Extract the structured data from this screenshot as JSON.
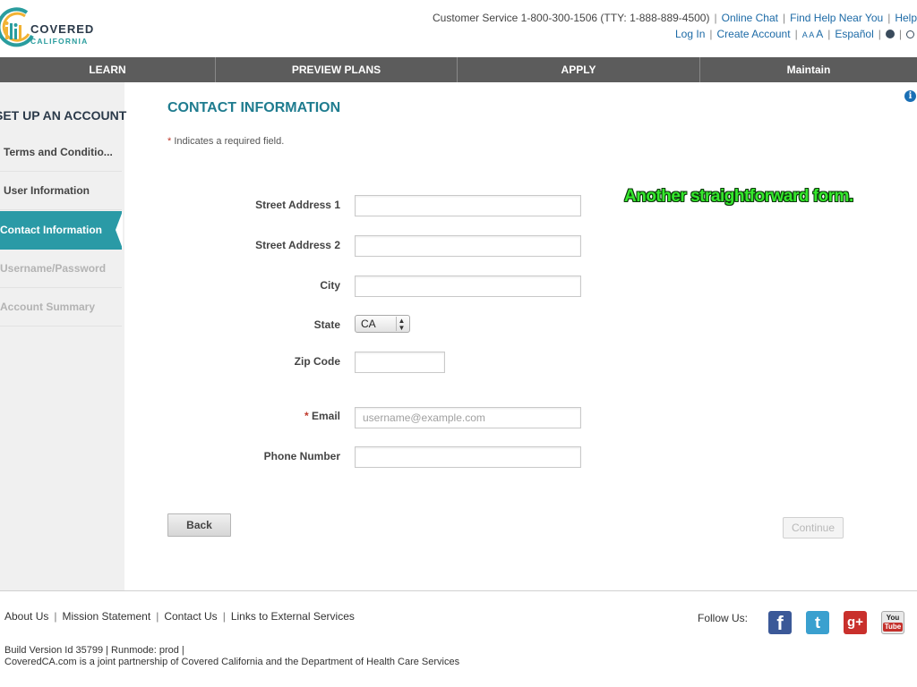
{
  "header": {
    "logo_line1": "COVERED",
    "logo_line2": "CALIFORNIA",
    "customer_service": "Customer Service 1-800-300-1506 (TTY: 1-888-889-4500)",
    "online_chat": "Online Chat",
    "find_help": "Find Help Near You",
    "help": "Help",
    "log_in": "Log In",
    "create_account": "Create Account",
    "text_size_small": "A A",
    "text_size_large": "A",
    "espanol": "Español"
  },
  "nav": {
    "items": [
      "LEARN",
      "PREVIEW PLANS",
      "APPLY",
      "Maintain"
    ]
  },
  "sidebar": {
    "title": "SET UP AN ACCOUNT",
    "items": [
      {
        "label": "Terms and Conditio...",
        "state": "done"
      },
      {
        "label": "User Information",
        "state": "done"
      },
      {
        "label": "Contact Information",
        "state": "active"
      },
      {
        "label": "Username/Password",
        "state": "future"
      },
      {
        "label": "Account Summary",
        "state": "future"
      }
    ]
  },
  "main": {
    "title": "CONTACT INFORMATION",
    "required_note": "Indicates a required field.",
    "required_marker": "*",
    "fields": {
      "street1_label": "Street Address 1",
      "street1_value": "",
      "street2_label": "Street Address 2",
      "street2_value": "",
      "city_label": "City",
      "city_value": "",
      "state_label": "State",
      "state_value": "CA",
      "zip_label": "Zip Code",
      "zip_value": "",
      "email_label": "Email",
      "email_placeholder": "username@example.com",
      "phone_label": "Phone Number",
      "phone_value": ""
    },
    "back_label": "Back",
    "continue_label": "Continue",
    "annotation": "Another straightforward form."
  },
  "footer": {
    "links": [
      "About Us",
      "Mission Statement",
      "Contact Us",
      "Links to External Services"
    ],
    "build": "Build Version Id 35799 |   Runmode: prod  |",
    "partnership": "CoveredCA.com is a joint partnership of Covered California and the Department of Health Care Services",
    "follow_us": "Follow Us:",
    "social": [
      "facebook-icon",
      "twitter-icon",
      "google-plus-icon",
      "youtube-icon"
    ],
    "youtube_you": "You",
    "youtube_tube": "Tube"
  },
  "colors": {
    "teal": "#2a9aa6",
    "title_teal": "#1f7c8f",
    "nav_gray": "#5c5c5c",
    "link_blue": "#1c6aa6"
  }
}
